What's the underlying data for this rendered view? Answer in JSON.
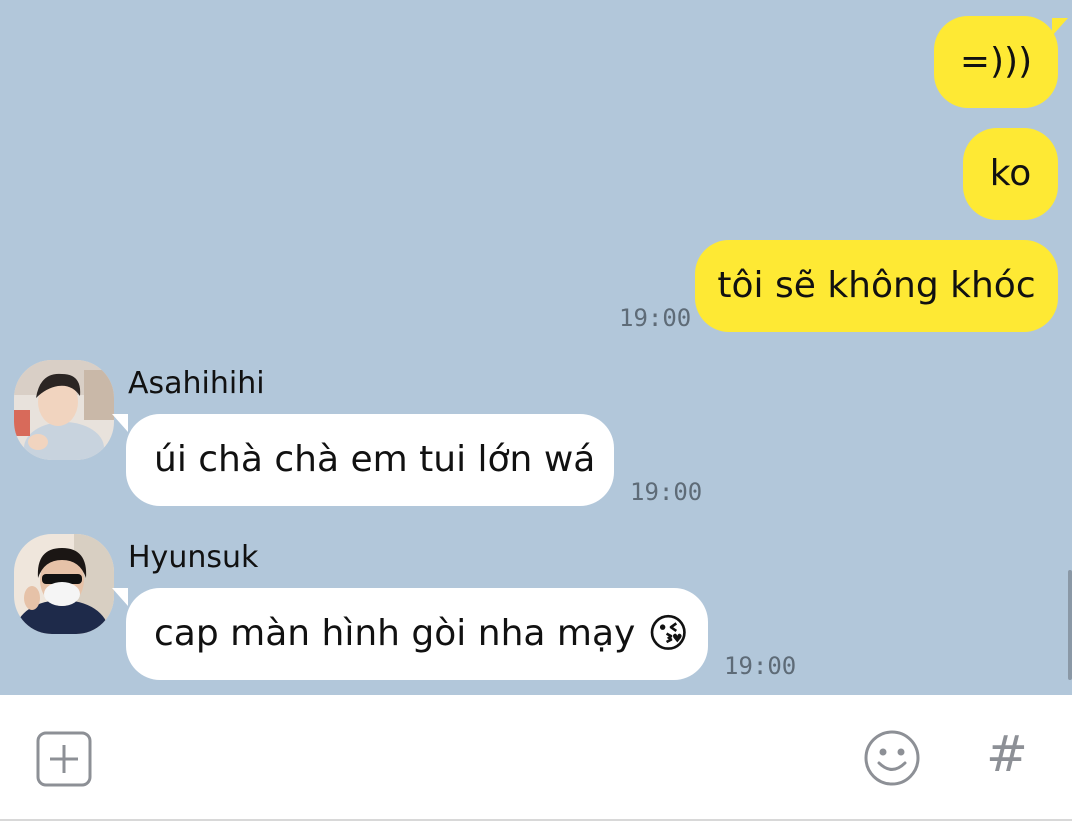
{
  "messages": [
    {
      "sender": "me",
      "text": "=)))"
    },
    {
      "sender": "me",
      "text": "ko"
    },
    {
      "sender": "me",
      "text": "tôi sẽ không khóc",
      "time": "19:00"
    },
    {
      "sender": "Asahihihi",
      "text": "úi chà chà em tui lớn wá",
      "time": "19:00",
      "avatar": "avatar-asahi"
    },
    {
      "sender": "Hyunsuk",
      "text": "cap màn hình gòi nha mạy",
      "emoji": "😘",
      "time": "19:00",
      "avatar": "avatar-hyunsuk"
    }
  ],
  "input_bar": {
    "attach_icon": "plus-square-icon",
    "emoji_icon": "smiley-icon",
    "hashtag_label": "#"
  },
  "colors": {
    "chat_background": "#b2c7da",
    "my_bubble": "#fee934",
    "their_bubble": "#ffffff",
    "time_text": "#5e6b77"
  }
}
